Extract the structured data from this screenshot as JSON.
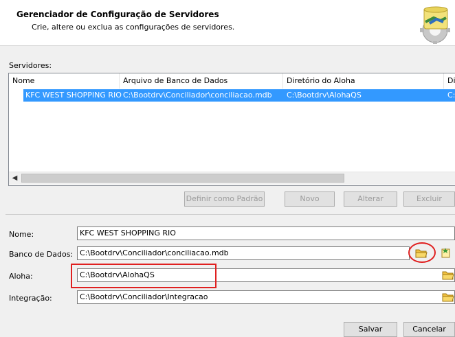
{
  "dialog": {
    "title": "Gerenciador de Configuração de Servidores",
    "subtitle": "Crie, altere ou exclua as configurações de servidores."
  },
  "servers": {
    "label": "Servidores:",
    "columns": [
      "Nome",
      "Arquivo de Banco de Dados",
      "Diretório do Aloha",
      "Di"
    ],
    "rows": [
      {
        "nome": "KFC WEST SHOPPING RIO",
        "arquivo": "C:\\Bootdrv\\Conciliador\\conciliacao.mdb",
        "diretorio": "C:\\Bootdrv\\AlohaQS",
        "extra": "C:"
      }
    ]
  },
  "buttons": {
    "definir_padrao": "Definir como Padrão",
    "novo": "Novo",
    "alterar": "Alterar",
    "excluir": "Excluir",
    "salvar": "Salvar",
    "cancelar": "Cancelar"
  },
  "form": {
    "nome_label": "Nome:",
    "nome_value": "KFC WEST SHOPPING RIO",
    "banco_label": "Banco de Dados:",
    "banco_value": "C:\\Bootdrv\\Conciliador\\conciliacao.mdb",
    "aloha_label": "Aloha:",
    "aloha_value": "C:\\Bootdrv\\AlohaQS",
    "integracao_label": "Integração:",
    "integracao_value": "C:\\Bootdrv\\Conciliador\\Integracao"
  },
  "colors": {
    "selection": "#3399ff",
    "annotation": "#e02020"
  }
}
